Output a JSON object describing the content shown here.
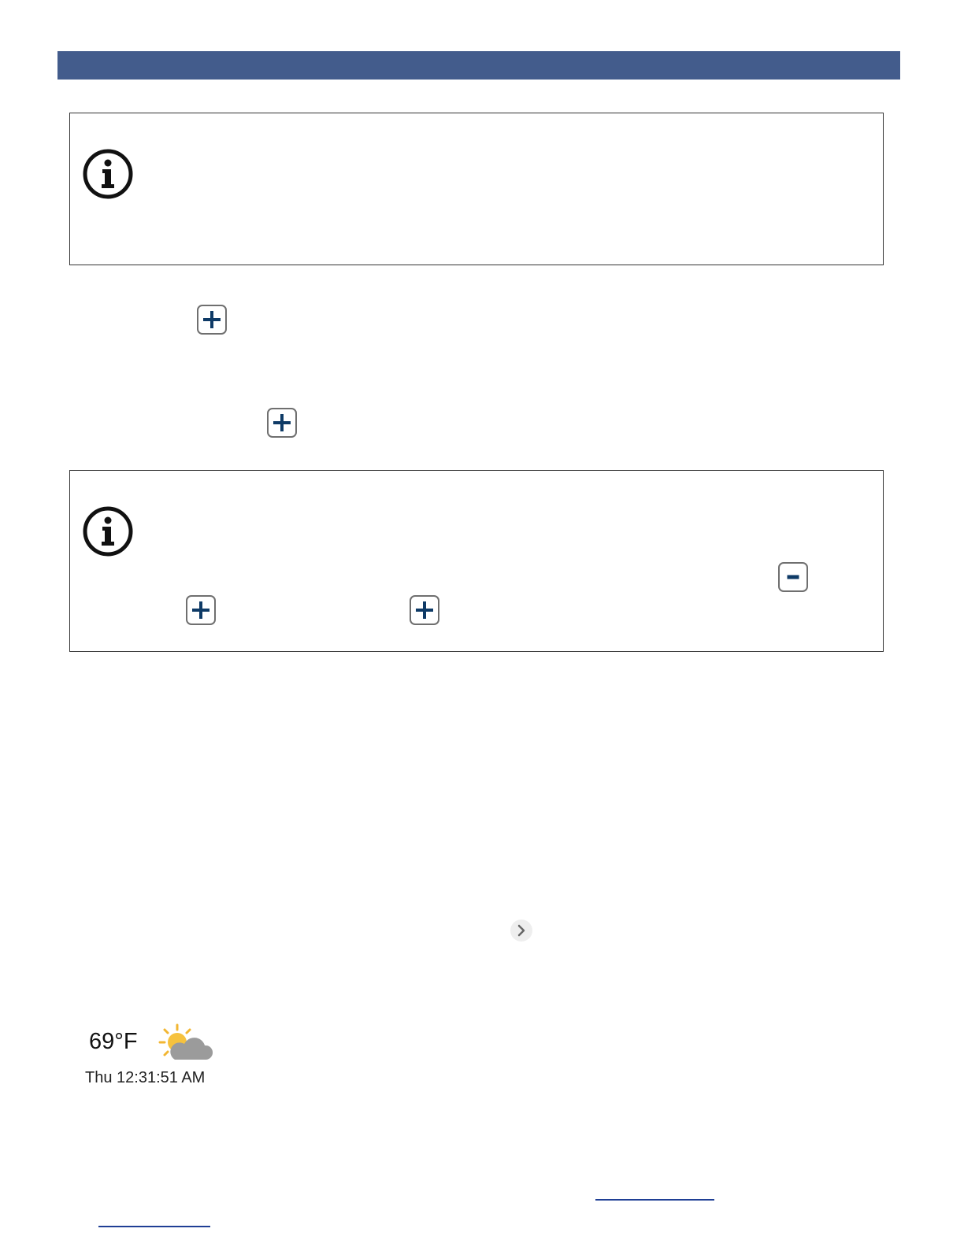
{
  "header": {
    "color": "#435c8c"
  },
  "notes": [
    {
      "icon": "info-circle-icon"
    },
    {
      "icon": "info-circle-icon"
    }
  ],
  "buttons": {
    "expand_symbol": "+",
    "collapse_symbol": "-",
    "expand_icon": "plus-icon",
    "collapse_icon": "minus-icon",
    "accent": "#0e3a66"
  },
  "carousel": {
    "icon": "chevron-right-icon"
  },
  "weather": {
    "temperature": "69°F",
    "condition_icon": "partly-cloudy-icon",
    "datetime": "Thu 12:31:51 AM"
  },
  "links": {
    "color": "#1f3f95"
  }
}
